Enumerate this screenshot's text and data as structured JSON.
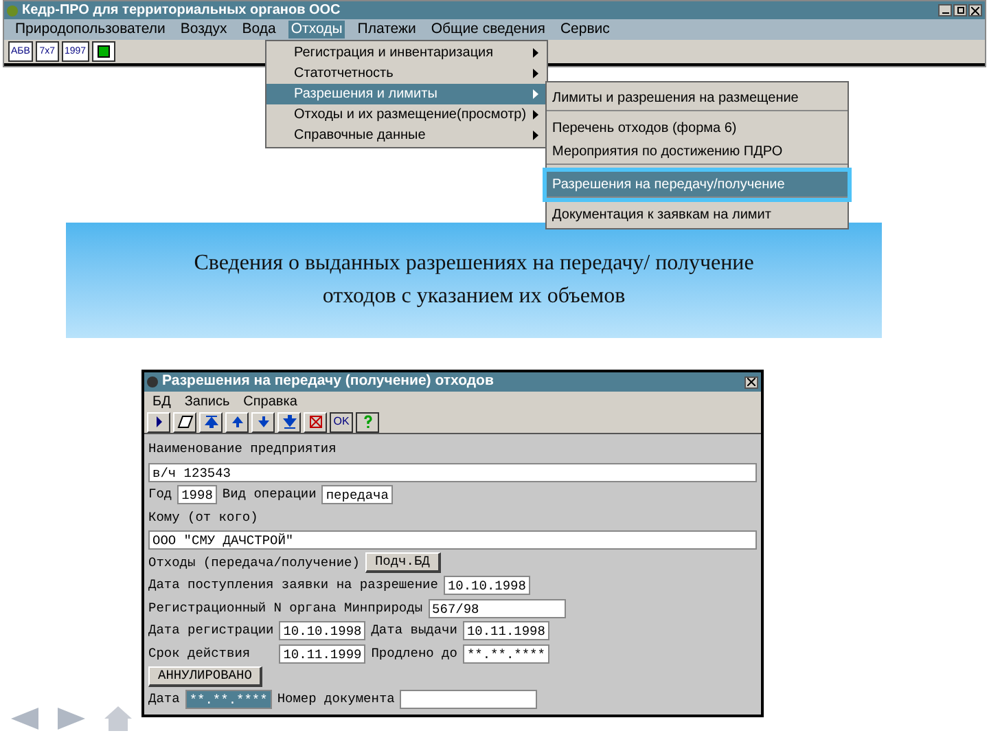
{
  "window": {
    "title": "Кедр-ПРО для территориальных органов ООС"
  },
  "menu_bar": [
    {
      "label": "Природопользователи",
      "selected": false
    },
    {
      "label": "Воздух",
      "selected": false
    },
    {
      "label": "Вода",
      "selected": false
    },
    {
      "label": "Отходы",
      "selected": true
    },
    {
      "label": "Платежи",
      "selected": false
    },
    {
      "label": "Общие сведения",
      "selected": false
    },
    {
      "label": "Сервис",
      "selected": false
    }
  ],
  "toolbar": [
    {
      "kind": "text",
      "label": "АБВ"
    },
    {
      "kind": "text",
      "label": "7x7"
    },
    {
      "kind": "text",
      "label": "1997"
    },
    {
      "kind": "cube"
    }
  ],
  "menu": [
    {
      "label": "Регистрация и инвентаризация",
      "selected": false
    },
    {
      "label": "Статотчетность",
      "selected": false
    },
    {
      "label": "Разрешения и лимиты",
      "selected": true
    },
    {
      "label": "Отходы и их размещение(просмотр)",
      "selected": false
    },
    {
      "label": "Справочные данные",
      "selected": false
    }
  ],
  "submenu": [
    {
      "label": "Лимиты и разрешения на размещение",
      "selected": false,
      "separator_after": true
    },
    {
      "label": "Перечень отходов (форма 6)",
      "selected": false,
      "separator_after": false
    },
    {
      "label": "Мероприятия по достижению ПДРО",
      "selected": false,
      "separator_after": true
    },
    {
      "label": "Разрешения на передачу/получение",
      "selected": true,
      "separator_after": true
    },
    {
      "label": "Документация к заявкам на лимит",
      "selected": false,
      "separator_after": false
    }
  ],
  "callout": "Сведения о выданных разрешениях на передачу/ получение отходов с указанием их объемов",
  "dialog": {
    "title": "Разрешения на передачу (получение) отходов",
    "menu": [
      "БД",
      "Запись",
      "Справка"
    ],
    "ok_label": "OK",
    "rows": [
      [
        {
          "kind": "label",
          "text": "Наименование предприятия"
        }
      ],
      [
        {
          "kind": "wide-field",
          "text": "в/ч 123543",
          "focused": false
        }
      ],
      [
        {
          "kind": "label",
          "text": "Год"
        },
        {
          "kind": "field",
          "text": "1998",
          "focused": false
        },
        {
          "kind": "label",
          "text": "Вид операции"
        },
        {
          "kind": "field",
          "text": "передача",
          "focused": false
        }
      ],
      [
        {
          "kind": "label",
          "text": "Кому (от кого)"
        }
      ],
      [
        {
          "kind": "wide-field",
          "text": "ООО \"СМУ ДАЧСТРОЙ\"",
          "focused": false
        }
      ],
      [
        {
          "kind": "label",
          "text": "Отходы (передача/получение)"
        },
        {
          "kind": "button",
          "text": "Подч.БД"
        }
      ],
      [
        {
          "kind": "label",
          "text": "Дата поступления заявки на разрешение"
        },
        {
          "kind": "field",
          "text": "10.10.1998",
          "focused": false
        }
      ],
      [
        {
          "kind": "label",
          "text": "Регистрационный N органа Минприроды"
        },
        {
          "kind": "long-field",
          "text": "567/98",
          "focused": false
        }
      ],
      [
        {
          "kind": "label",
          "text": "Дата регистрации"
        },
        {
          "kind": "field",
          "text": "10.10.1998",
          "focused": false
        },
        {
          "kind": "label",
          "text": "Дата выдачи"
        },
        {
          "kind": "field",
          "text": "10.11.1998",
          "focused": false
        }
      ],
      [
        {
          "kind": "label",
          "text": "Срок действия   "
        },
        {
          "kind": "field",
          "text": "10.11.1999",
          "focused": false
        },
        {
          "kind": "label",
          "text": "Продлено до"
        },
        {
          "kind": "field",
          "text": "**.**.****",
          "focused": false
        }
      ],
      [
        {
          "kind": "button",
          "text": "АННУЛИРОВАНО"
        }
      ],
      [
        {
          "kind": "label",
          "text": "Дата"
        },
        {
          "kind": "field",
          "text": "**.**.****",
          "focused": true
        },
        {
          "kind": "label",
          "text": "Номер документа"
        },
        {
          "kind": "long-field",
          "focused": false
        }
      ]
    ]
  }
}
